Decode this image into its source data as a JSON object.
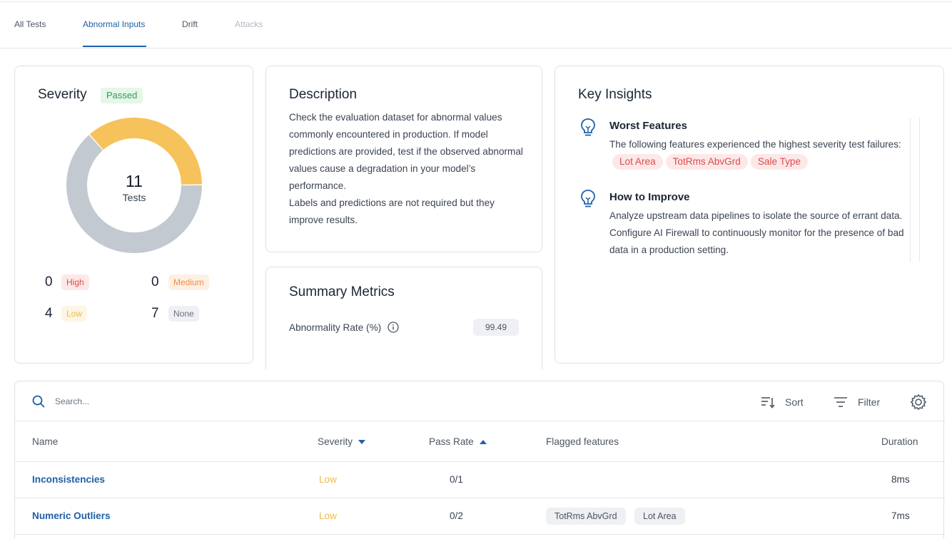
{
  "tabs": [
    {
      "label": "All Tests",
      "state": "normal"
    },
    {
      "label": "Abnormal Inputs",
      "state": "active"
    },
    {
      "label": "Drift",
      "state": "normal"
    },
    {
      "label": "Attacks",
      "state": "disabled"
    }
  ],
  "severity_card": {
    "title": "Severity",
    "status_badge": "Passed",
    "donut": {
      "total": "11",
      "unit": "Tests",
      "segments": [
        {
          "label": "Low",
          "value": 4,
          "color": "#f6c25b"
        },
        {
          "label": "None",
          "value": 7,
          "color": "#c3c9d0"
        }
      ]
    },
    "counts": [
      {
        "count": "0",
        "label": "High"
      },
      {
        "count": "0",
        "label": "Medium"
      },
      {
        "count": "4",
        "label": "Low"
      },
      {
        "count": "7",
        "label": "None"
      }
    ]
  },
  "description_card": {
    "title": "Description",
    "paragraphs": [
      "Check the evaluation dataset for abnormal values commonly encountered in production. If model predictions are provided, test if the observed abnormal values cause a degradation in your model’s performance.",
      "Labels and predictions are not required but they improve results."
    ]
  },
  "summary_card": {
    "title": "Summary Metrics",
    "metric_label": "Abnormality Rate (%)",
    "metric_value": "99.49"
  },
  "insights_card": {
    "title": "Key Insights",
    "worst": {
      "title": "Worst Features",
      "text": "The following features experienced the highest severity test failures:",
      "features": [
        "Lot Area",
        "TotRms AbvGrd",
        "Sale Type"
      ]
    },
    "improve": {
      "title": "How to Improve",
      "text": "Analyze upstream data pipelines to isolate the source of errant data. Configure AI Firewall to continuously monitor for the presence of bad data in a production setting."
    }
  },
  "table": {
    "search_placeholder": "Search...",
    "sort_label": "Sort",
    "filter_label": "Filter",
    "columns": {
      "name": "Name",
      "severity": "Severity",
      "pass_rate": "Pass Rate",
      "flagged": "Flagged features",
      "duration": "Duration"
    },
    "rows": [
      {
        "name": "Inconsistencies",
        "severity": "Low",
        "pass_rate": "0/1",
        "flagged": [],
        "duration": "8ms"
      },
      {
        "name": "Numeric Outliers",
        "severity": "Low",
        "pass_rate": "0/2",
        "flagged": [
          "TotRms AbvGrd",
          "Lot Area"
        ],
        "duration": "7ms"
      }
    ]
  }
}
